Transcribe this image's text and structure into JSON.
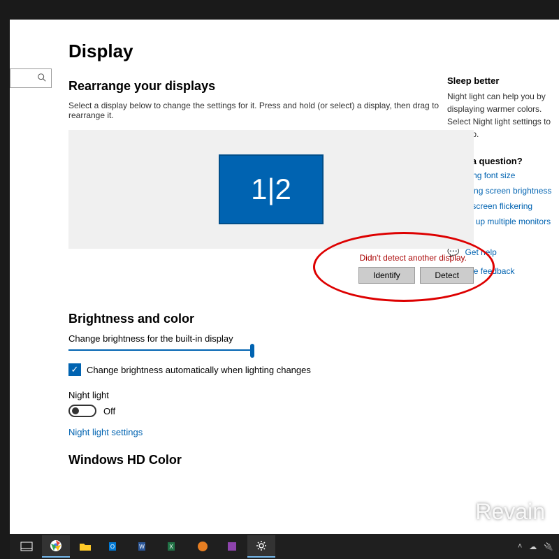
{
  "page": {
    "title": "Display",
    "rearrange_heading": "Rearrange your displays",
    "rearrange_desc": "Select a display below to change the settings for it. Press and hold (or select) a display, then drag to rearrange it.",
    "monitor_label": "1|2",
    "detect_error": "Didn't detect another display.",
    "identify_btn": "Identify",
    "detect_btn": "Detect",
    "brightness_heading": "Brightness and color",
    "brightness_label": "Change brightness for the built-in display",
    "auto_brightness": "Change brightness automatically when lighting changes",
    "night_light_label": "Night light",
    "night_light_state": "Off",
    "night_light_link": "Night light settings",
    "hd_color_heading": "Windows HD Color"
  },
  "sidebar": {
    "sleep_heading": "Sleep better",
    "sleep_text": "Night light can help you by displaying warmer colors. Select Night light settings to set it up.",
    "question_heading": "Have a question?",
    "links": [
      "Adjusting font size",
      "Changing screen brightness",
      "Fixing screen flickering",
      "Setting up multiple monitors"
    ],
    "get_help": "Get help",
    "give_feedback": "Give feedback"
  },
  "watermark": "Revain"
}
